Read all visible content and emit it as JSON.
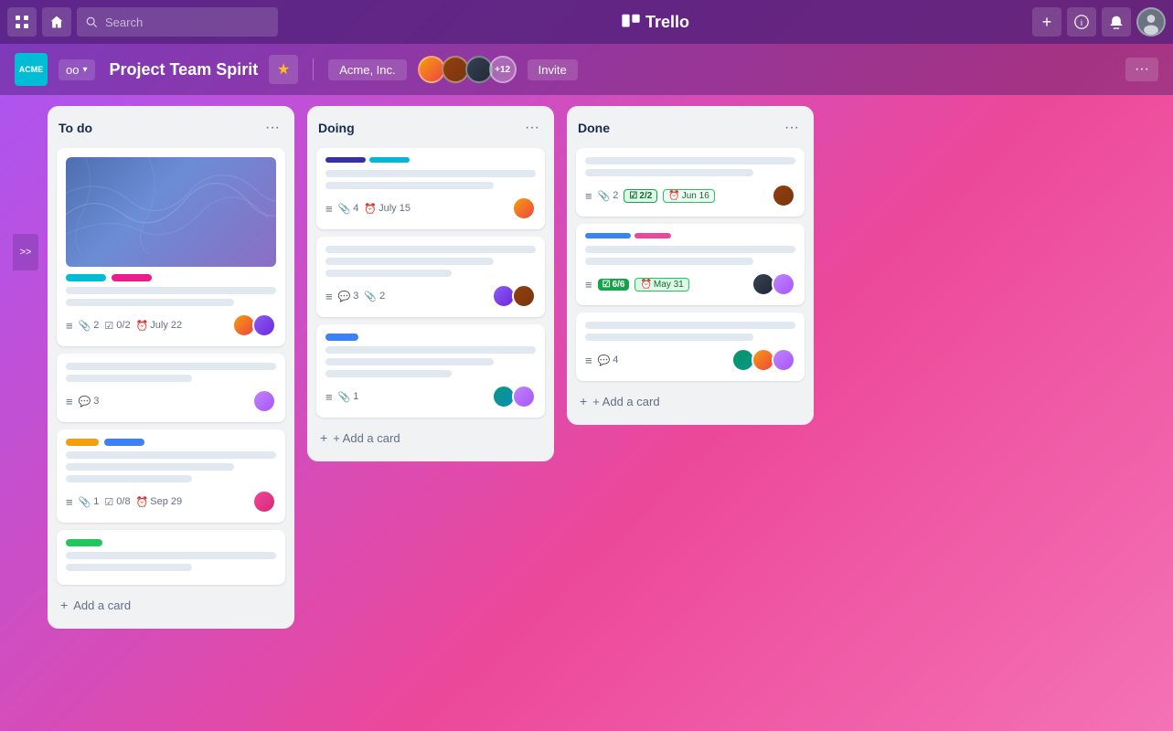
{
  "app": {
    "name": "Trello"
  },
  "topNav": {
    "searchPlaceholder": "Search",
    "addLabel": "+",
    "infoLabel": "ℹ",
    "notifLabel": "🔔"
  },
  "boardHeader": {
    "workspaceLogo": "ACME",
    "workspaceShort": "ഠഠ",
    "boardTitle": "Project Team Spirit",
    "starLabel": "★",
    "workspaceName": "Acme, Inc.",
    "memberCount": "+12",
    "inviteLabel": "Invite",
    "moreLabel": "···"
  },
  "sidebarToggle": ">>",
  "lists": [
    {
      "id": "todo",
      "title": "To do",
      "cards": [
        {
          "id": "card-todo-1",
          "hasCover": true,
          "tags": [
            "cyan",
            "pink"
          ],
          "lines": [
            "full",
            "medium"
          ],
          "meta": {
            "paperclip": "2",
            "check": "0/2",
            "date": "July 22"
          },
          "avatars": [
            "orange",
            "purple"
          ]
        },
        {
          "id": "card-todo-2",
          "hasCover": false,
          "tags": [],
          "lines": [
            "full",
            "short"
          ],
          "meta": {
            "comment": "3"
          },
          "avatars": [
            "light-purple"
          ]
        },
        {
          "id": "card-todo-3",
          "hasCover": false,
          "tags": [
            "yellow",
            "blue"
          ],
          "lines": [
            "full",
            "medium",
            "short"
          ],
          "meta": {
            "paperclip": "1",
            "check": "0/8",
            "date": "Sep 29"
          },
          "avatars": [
            "pink"
          ]
        },
        {
          "id": "card-todo-4",
          "hasCover": false,
          "tags": [
            "green"
          ],
          "lines": [
            "full",
            "short"
          ],
          "meta": {},
          "avatars": []
        }
      ]
    },
    {
      "id": "doing",
      "title": "Doing",
      "cards": [
        {
          "id": "card-doing-1",
          "hasCover": false,
          "progressBars": [
            "darkblue",
            "teal"
          ],
          "lines": [
            "full",
            "medium"
          ],
          "meta": {
            "paperclip": "4",
            "date": "July 15"
          },
          "avatars": [
            "orange"
          ]
        },
        {
          "id": "card-doing-2",
          "hasCover": false,
          "tags": [],
          "lines": [
            "full",
            "medium",
            "short"
          ],
          "meta": {
            "comment": "3",
            "paperclip": "2"
          },
          "avatars": [
            "purple",
            "brown"
          ]
        },
        {
          "id": "card-doing-3",
          "hasCover": false,
          "tags": [
            "blue"
          ],
          "lines": [
            "full",
            "medium",
            "short"
          ],
          "meta": {
            "paperclip": "1"
          },
          "avatars": [
            "teal",
            "light-purple"
          ]
        }
      ]
    },
    {
      "id": "done",
      "title": "Done",
      "cards": [
        {
          "id": "card-done-1",
          "hasCover": false,
          "lines": [
            "full",
            "medium"
          ],
          "meta": {
            "paperclip": "2",
            "checkBadge": "2/2",
            "dateBadge": "Jun 16"
          },
          "avatars": [
            "brown"
          ]
        },
        {
          "id": "card-done-2",
          "hasCover": false,
          "progressBars": [
            "blue",
            "pink"
          ],
          "lines": [
            "full",
            "medium"
          ],
          "meta": {
            "checkBadge": "6/6",
            "dateBadge2": "May 31"
          },
          "avatars": [
            "dark",
            "light-purple"
          ]
        },
        {
          "id": "card-done-3",
          "hasCover": false,
          "lines": [
            "full",
            "medium"
          ],
          "meta": {
            "comment": "4"
          },
          "avatars": [
            "green",
            "orange",
            "light-purple"
          ]
        }
      ]
    }
  ],
  "addCard": "+ Add a card",
  "icons": {
    "paperclip": "📎",
    "check": "☑",
    "clock": "⏰",
    "comment": "💬",
    "menu": "≡",
    "more": "···",
    "search": "🔍",
    "home": "🏠",
    "plus": "+",
    "info": "ⓘ",
    "bell": "🔔",
    "star": "★",
    "chevronDown": "▾",
    "collapse": "»"
  }
}
